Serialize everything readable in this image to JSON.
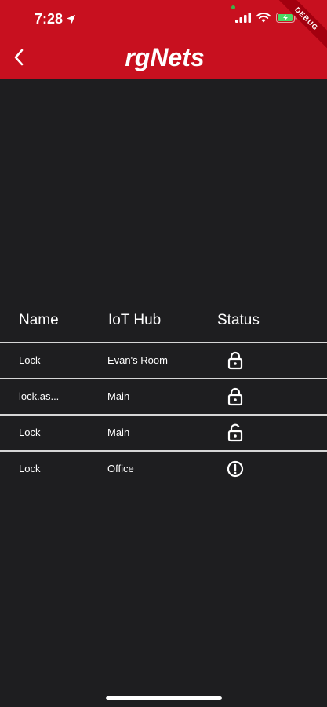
{
  "status_bar": {
    "time": "7:28",
    "debug_label": "DEBUG"
  },
  "header": {
    "logo_text": "rgNets",
    "brand_color": "#c8101f"
  },
  "table": {
    "columns": [
      "Name",
      "IoT Hub",
      "Status"
    ],
    "rows": [
      {
        "name": "Lock",
        "hub": "Evan's Room",
        "status": "lock-icon"
      },
      {
        "name": "lock.as...",
        "hub": "Main",
        "status": "lock-icon"
      },
      {
        "name": "Lock",
        "hub": "Main",
        "status": "unlock-icon"
      },
      {
        "name": "Lock",
        "hub": "Office",
        "status": "alert-icon"
      }
    ]
  }
}
